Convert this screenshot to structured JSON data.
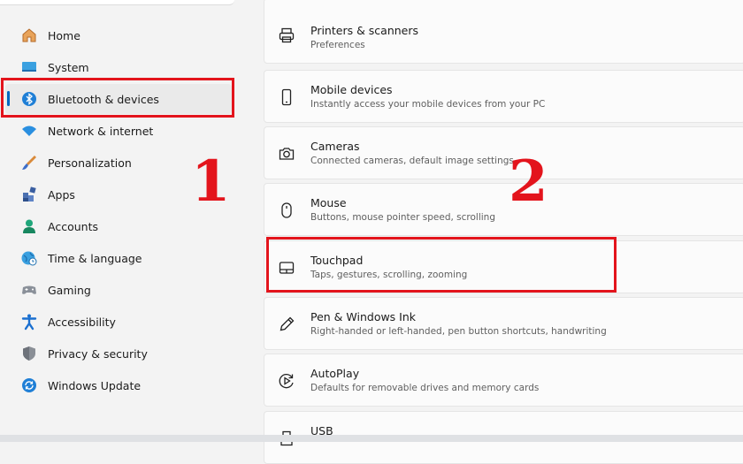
{
  "sidebar": {
    "items": [
      {
        "label": "Home",
        "icon": "home-icon"
      },
      {
        "label": "System",
        "icon": "system-display-icon"
      },
      {
        "label": "Bluetooth & devices",
        "icon": "bluetooth-icon",
        "selected": true
      },
      {
        "label": "Network & internet",
        "icon": "wifi-icon"
      },
      {
        "label": "Personalization",
        "icon": "brush-icon"
      },
      {
        "label": "Apps",
        "icon": "apps-icon"
      },
      {
        "label": "Accounts",
        "icon": "account-icon"
      },
      {
        "label": "Time & language",
        "icon": "globe-clock-icon"
      },
      {
        "label": "Gaming",
        "icon": "gamepad-icon"
      },
      {
        "label": "Accessibility",
        "icon": "accessibility-icon"
      },
      {
        "label": "Privacy & security",
        "icon": "shield-icon"
      },
      {
        "label": "Windows Update",
        "icon": "update-icon"
      }
    ]
  },
  "main": {
    "cards": [
      {
        "title": "Printers & scanners",
        "subtitle": "Preferences",
        "icon": "printer-icon"
      },
      {
        "title": "Mobile devices",
        "subtitle": "Instantly access your mobile devices from your PC",
        "icon": "phone-icon"
      },
      {
        "title": "Cameras",
        "subtitle": "Connected cameras, default image settings",
        "icon": "camera-icon"
      },
      {
        "title": "Mouse",
        "subtitle": "Buttons, mouse pointer speed, scrolling",
        "icon": "mouse-icon"
      },
      {
        "title": "Touchpad",
        "subtitle": "Taps, gestures, scrolling, zooming",
        "icon": "touchpad-icon"
      },
      {
        "title": "Pen & Windows Ink",
        "subtitle": "Right-handed or left-handed, pen button shortcuts, handwriting",
        "icon": "pen-icon"
      },
      {
        "title": "AutoPlay",
        "subtitle": "Defaults for removable drives and memory cards",
        "icon": "autoplay-icon"
      },
      {
        "title": "USB",
        "subtitle": "",
        "icon": "usb-icon"
      }
    ]
  },
  "annotations": {
    "step1": "1",
    "step2": "2",
    "highlight_color": "#e3141c"
  },
  "colors": {
    "accent": "#0067c0",
    "background": "#f3f3f3",
    "card": "#fbfbfb"
  }
}
